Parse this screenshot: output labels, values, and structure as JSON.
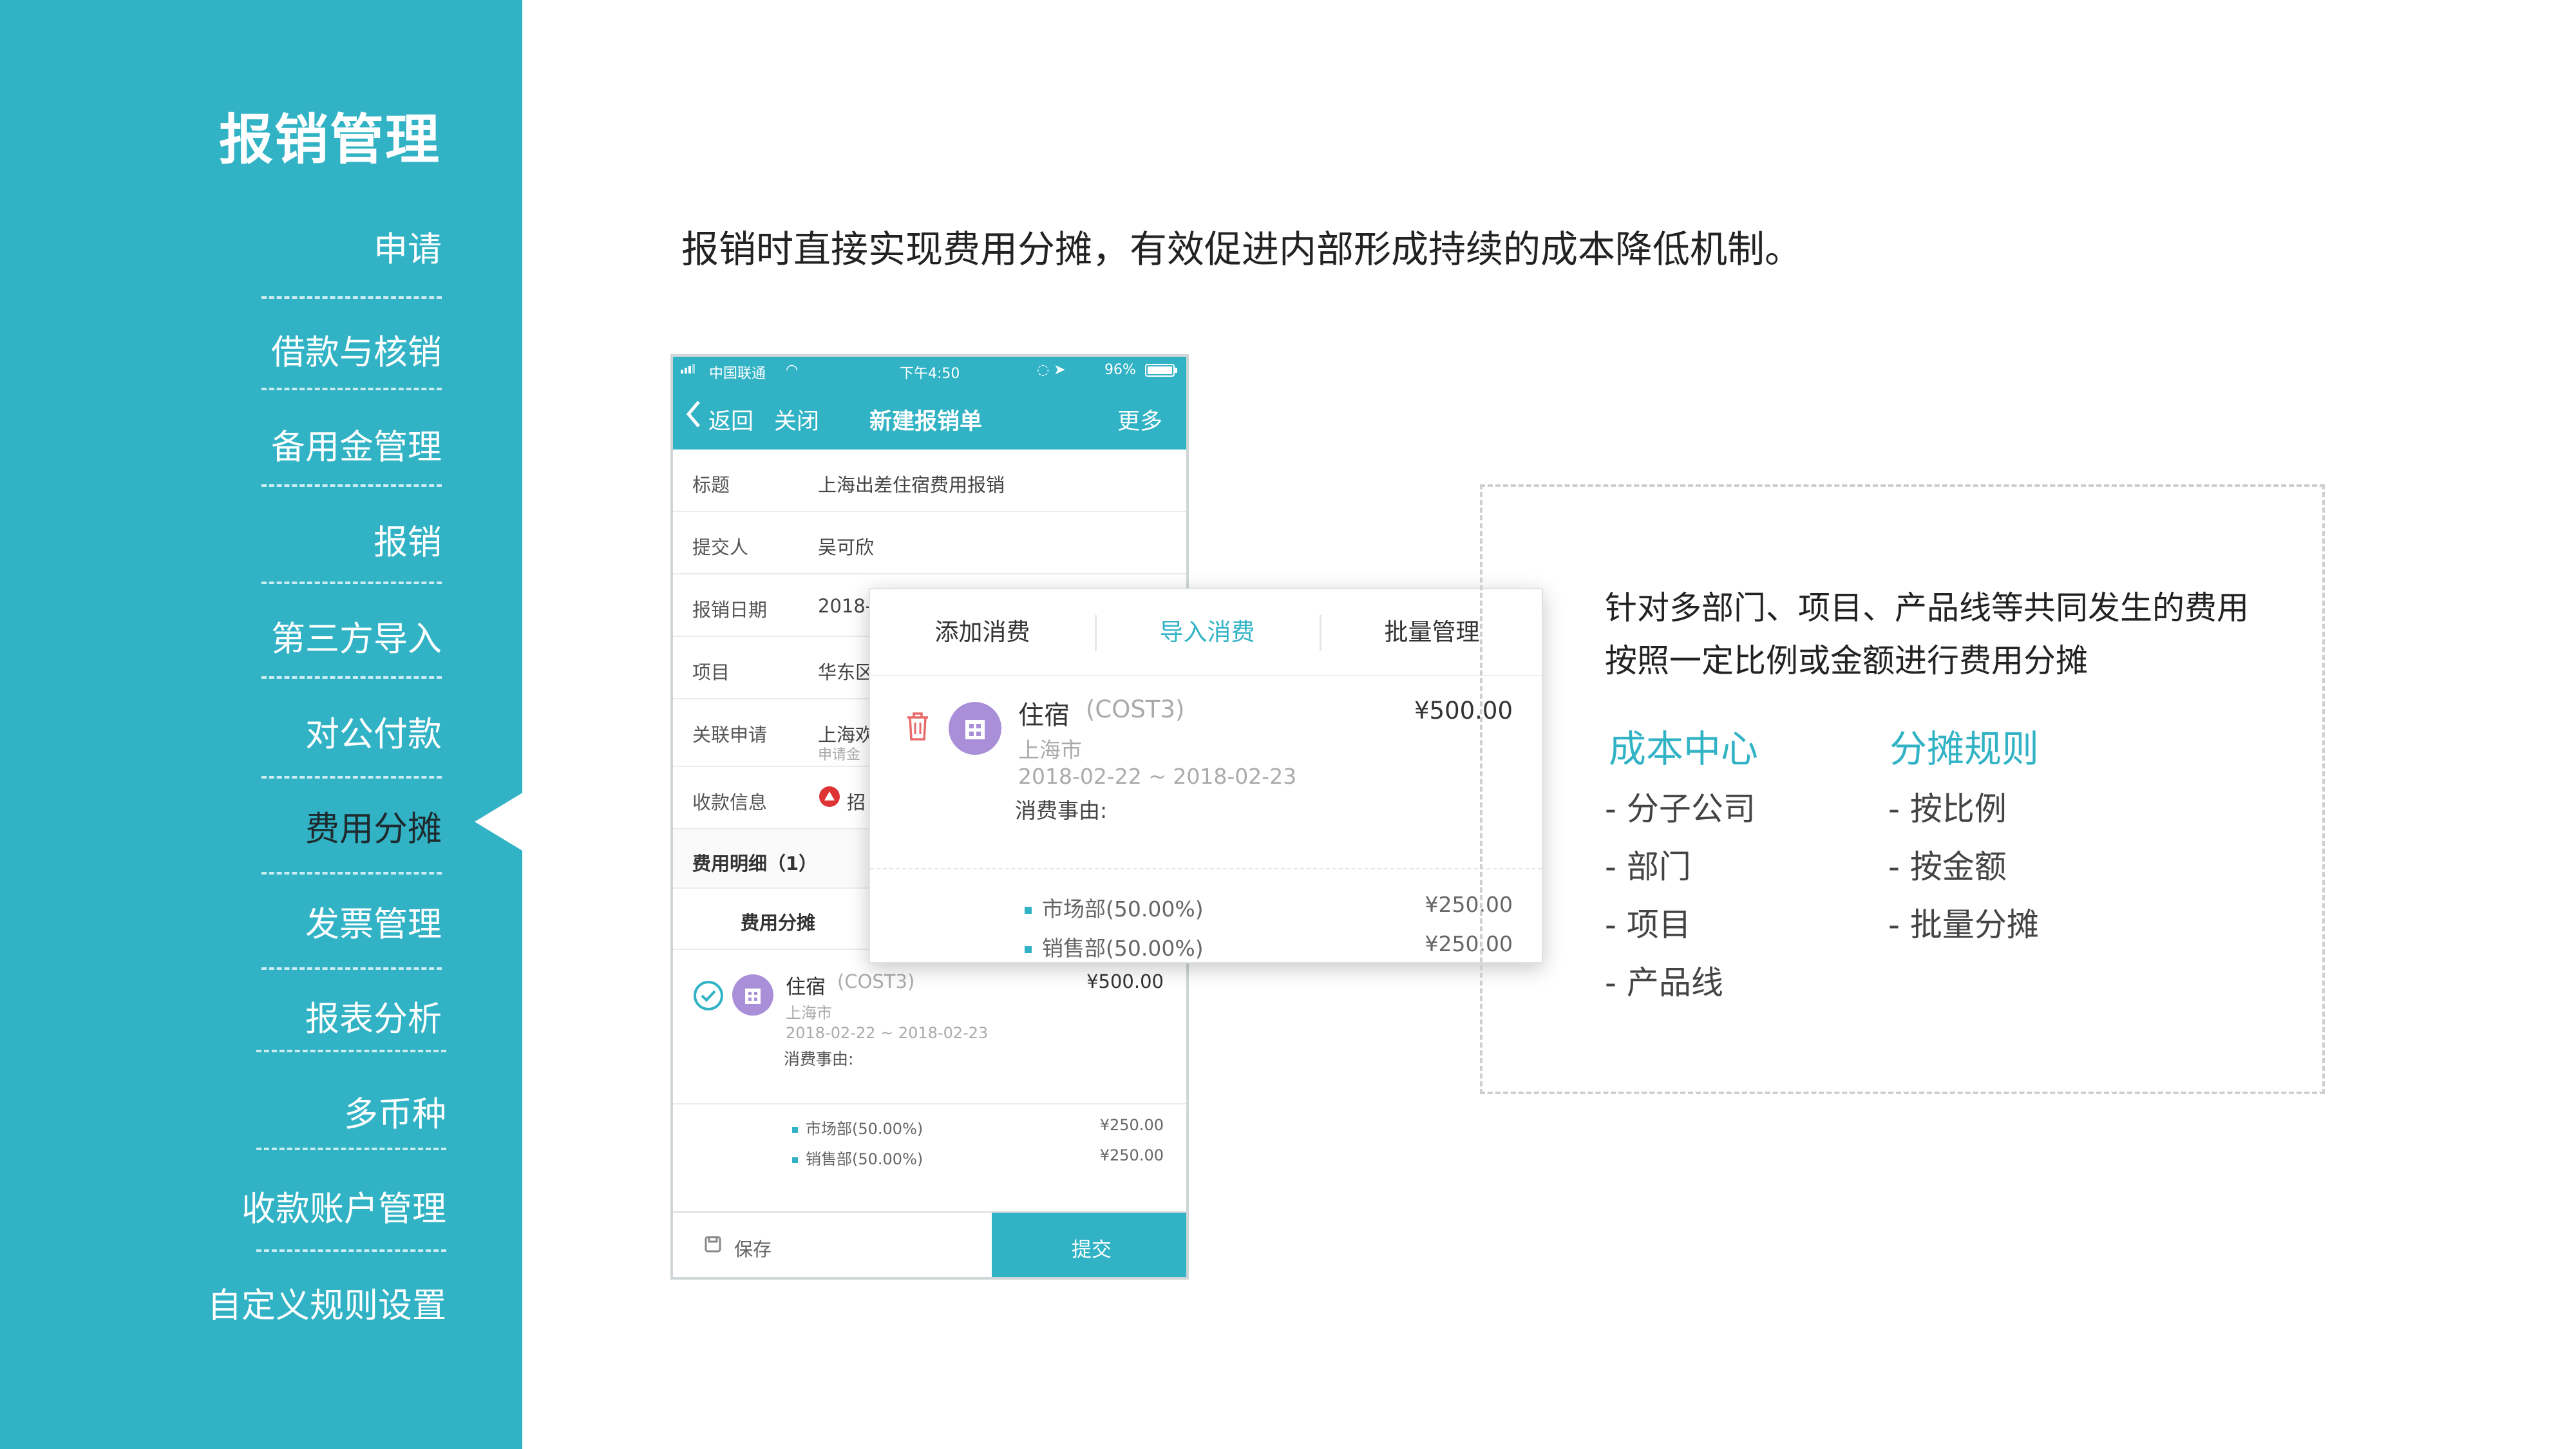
{
  "sidebar": {
    "title": "报销管理",
    "items": [
      {
        "label": "申请"
      },
      {
        "label": "借款与核销"
      },
      {
        "label": "备用金管理"
      },
      {
        "label": "报销"
      },
      {
        "label": "第三方导入"
      },
      {
        "label": "对公付款"
      },
      {
        "label": "费用分摊",
        "active": true
      },
      {
        "label": "发票管理"
      },
      {
        "label": "报表分析"
      },
      {
        "label": "多币种"
      },
      {
        "label": "收款账户管理"
      },
      {
        "label": "自定义规则设置"
      }
    ]
  },
  "headline": "报销时直接实现费用分摊，有效促进内部形成持续的成本降低机制。",
  "phone": {
    "status": {
      "carrier": "中国联通",
      "time": "下午4:50",
      "battery": "96%"
    },
    "nav": {
      "back": "返回",
      "close": "关闭",
      "title": "新建报销单",
      "more": "更多"
    },
    "form": [
      {
        "label": "标题",
        "value": "上海出差住宿费用报销"
      },
      {
        "label": "提交人",
        "value": "吴可欣"
      },
      {
        "label": "报销日期",
        "value": "2018-0"
      },
      {
        "label": "项目",
        "value": "华东区"
      },
      {
        "label": "关联申请",
        "value": "上海欢",
        "sub": "申请金"
      },
      {
        "label": "收款信息",
        "value": "招"
      }
    ],
    "detail_header": "费用明细（1）",
    "alloc_header": "费用分摊",
    "expense": {
      "name": "住宿",
      "code": "(COST3)",
      "amount": "¥500.00",
      "city": "上海市",
      "dates": "2018-02-22 ~ 2018-02-23",
      "reason_label": "消费事由:"
    },
    "allocations": [
      {
        "dept": "市场部(50.00%)",
        "amount": "¥250.00"
      },
      {
        "dept": "销售部(50.00%)",
        "amount": "¥250.00"
      }
    ],
    "bottom": {
      "save": "保存",
      "submit": "提交"
    }
  },
  "popup": {
    "tabs": [
      "添加消费",
      "导入消费",
      "批量管理"
    ],
    "active_tab": "导入消费",
    "expense": {
      "name": "住宿",
      "code": "(COST3)",
      "amount": "¥500.00",
      "city": "上海市",
      "dates": "2018-02-22 ~ 2018-02-23",
      "reason_label": "消费事由:"
    },
    "allocations": [
      {
        "dept": "市场部(50.00%)",
        "amount": "¥250.00"
      },
      {
        "dept": "销售部(50.00%)",
        "amount": "¥250.00"
      }
    ]
  },
  "info": {
    "desc_line1": "针对多部门、项目、产品线等共同发生的费用",
    "desc_line2": "按照一定比例或金额进行费用分摊",
    "cost_center": {
      "heading": "成本中心",
      "items": [
        "- 分子公司",
        "- 部门",
        "-   项目",
        "-   产品线"
      ]
    },
    "rules": {
      "heading": "分摊规则",
      "items": [
        "- 按比例",
        "- 按金额",
        "- 批量分摊"
      ]
    }
  },
  "colors": {
    "accent": "#31b3c5",
    "icon_purple": "#a88fd8",
    "delete_red": "#e86a6a"
  }
}
